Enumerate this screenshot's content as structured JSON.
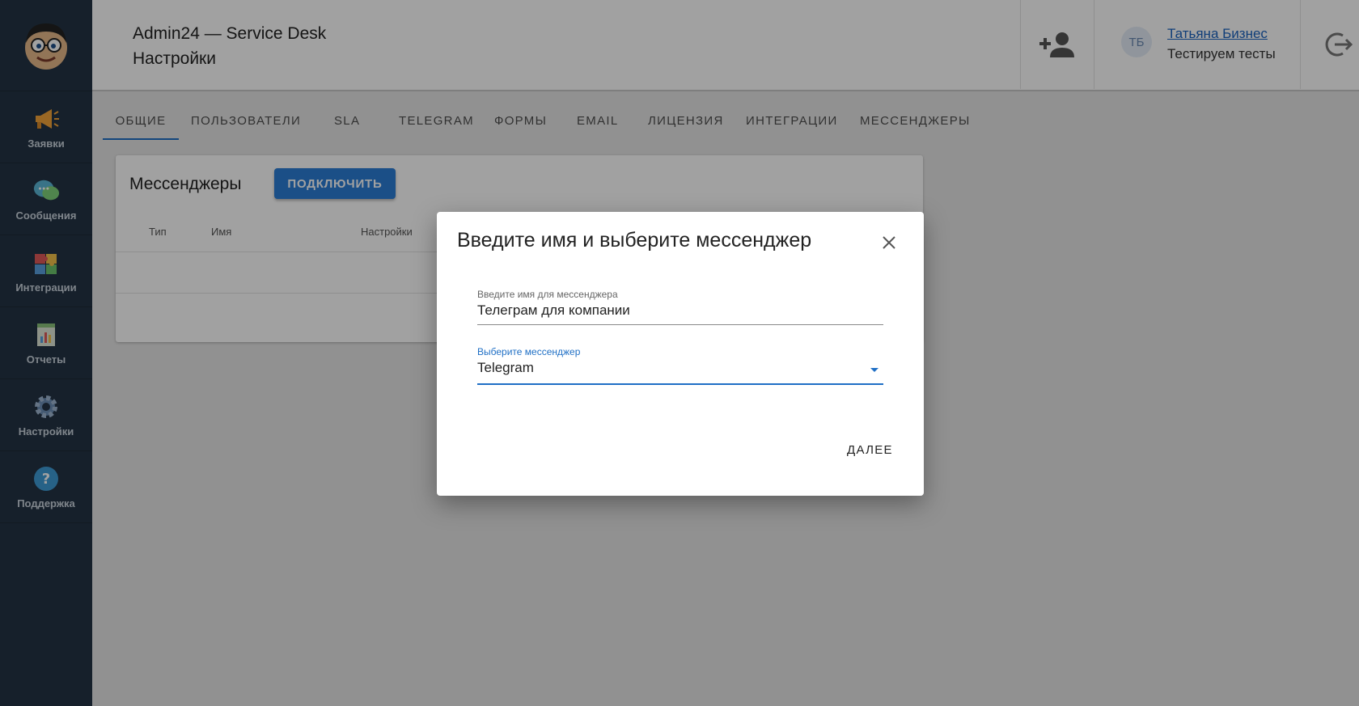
{
  "sidebar": {
    "items": [
      {
        "label": "Заявки",
        "icon": "megaphone-icon"
      },
      {
        "label": "Сообщения",
        "icon": "chat-bubbles-icon"
      },
      {
        "label": "Интеграции",
        "icon": "puzzle-icon"
      },
      {
        "label": "Отчеты",
        "icon": "report-icon"
      },
      {
        "label": "Настройки",
        "icon": "gear-icon"
      },
      {
        "label": "Поддержка",
        "icon": "help-icon"
      }
    ]
  },
  "header": {
    "app_title": "Admin24 — Service Desk",
    "page_title": "Настройки",
    "avatar_initials": "ТБ",
    "user_name": "Татьяна Бизнес",
    "user_subtitle": "Тестируем тесты"
  },
  "tabs": [
    {
      "label": "ОБЩИЕ",
      "active": true
    },
    {
      "label": "ПОЛЬЗОВАТЕЛИ"
    },
    {
      "label": "SLA"
    },
    {
      "label": "TELEGRAM"
    },
    {
      "label": "ФОРМЫ"
    },
    {
      "label": "EMAIL"
    },
    {
      "label": "ЛИЦЕНЗИЯ"
    },
    {
      "label": "ИНТЕГРАЦИИ"
    },
    {
      "label": "МЕССЕНДЖЕРЫ"
    }
  ],
  "card": {
    "title": "Мессенджеры",
    "connect_label": "ПОДКЛЮЧИТЬ",
    "columns": [
      "Тип",
      "Имя",
      "Настройки"
    ]
  },
  "dialog": {
    "title": "Введите имя и выберите мессенджер",
    "name_label": "Введите имя для мессенджера",
    "name_value": "Телеграм для компании",
    "select_label": "Выберите мессенджер",
    "select_value": "Telegram",
    "next_label": "ДАЛЕЕ"
  },
  "colors": {
    "sidebar_bg": "#243445",
    "accent": "#1f6fc5",
    "button_bg": "#2b7dd6"
  }
}
